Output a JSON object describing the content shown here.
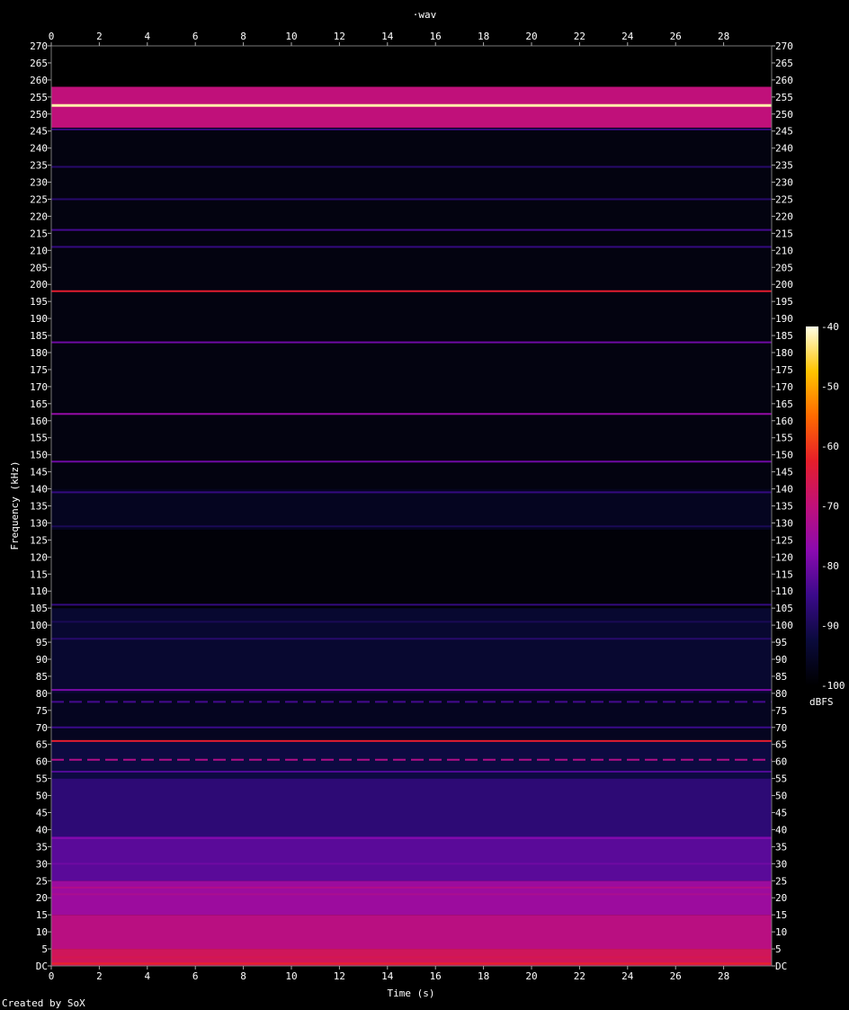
{
  "chart_data": {
    "type": "heatmap",
    "title": "·wav",
    "xlabel": "Time (s)",
    "ylabel": "Frequency (kHz)",
    "xlim": [
      0,
      30
    ],
    "ylim": [
      0,
      270
    ],
    "x_ticks": [
      0,
      2,
      4,
      6,
      8,
      10,
      12,
      14,
      16,
      18,
      20,
      22,
      24,
      26,
      28
    ],
    "y_ticks": [
      0,
      5,
      10,
      15,
      20,
      25,
      30,
      35,
      40,
      45,
      50,
      55,
      60,
      65,
      70,
      75,
      80,
      85,
      90,
      95,
      100,
      105,
      110,
      115,
      120,
      125,
      130,
      135,
      140,
      145,
      150,
      155,
      160,
      165,
      170,
      175,
      180,
      185,
      190,
      195,
      200,
      205,
      210,
      215,
      220,
      225,
      230,
      235,
      240,
      245,
      250,
      255,
      260,
      265,
      270
    ],
    "y_tick_zero_label": "DC",
    "colorbar": {
      "label": "dBFS",
      "range": [
        -100,
        -40
      ],
      "ticks": [
        -40,
        -50,
        -60,
        -70,
        -80,
        -90,
        -100
      ],
      "colors": [
        "#000000",
        "#0a0a3c",
        "#3a0a8a",
        "#8a0ab0",
        "#c0107a",
        "#e61e2a",
        "#ff6a00",
        "#ffc400",
        "#ffffe6"
      ]
    },
    "bands": [
      {
        "f_lo": 0,
        "f_hi": 5,
        "level_db": -67
      },
      {
        "f_lo": 5,
        "f_hi": 15,
        "level_db": -71
      },
      {
        "f_lo": 15,
        "f_hi": 25,
        "level_db": -75
      },
      {
        "f_lo": 25,
        "f_hi": 38,
        "level_db": -82
      },
      {
        "f_lo": 38,
        "f_hi": 55,
        "level_db": -87
      },
      {
        "f_lo": 55,
        "f_hi": 66,
        "level_db": -92
      },
      {
        "f_lo": 66,
        "f_hi": 80,
        "level_db": -96
      },
      {
        "f_lo": 80,
        "f_hi": 105,
        "level_db": -94
      },
      {
        "f_lo": 105,
        "f_hi": 128,
        "level_db": -99
      },
      {
        "f_lo": 128,
        "f_hi": 140,
        "level_db": -96
      },
      {
        "f_lo": 140,
        "f_hi": 246,
        "level_db": -98
      },
      {
        "f_lo": 246,
        "f_hi": 258,
        "level_db": -70
      },
      {
        "f_lo": 258,
        "f_hi": 270,
        "level_db": -100
      }
    ],
    "tones": [
      {
        "freq": 0.7,
        "level_db": -62
      },
      {
        "freq": 2.5,
        "level_db": -66
      },
      {
        "freq": 21,
        "level_db": -73
      },
      {
        "freq": 23,
        "level_db": -72
      },
      {
        "freq": 30,
        "level_db": -80
      },
      {
        "freq": 37.5,
        "level_db": -78
      },
      {
        "freq": 57,
        "level_db": -83
      },
      {
        "freq": 60.5,
        "level_db": -72,
        "dashed": true
      },
      {
        "freq": 66,
        "level_db": -63
      },
      {
        "freq": 70,
        "level_db": -85
      },
      {
        "freq": 77.5,
        "level_db": -84,
        "dashed": true
      },
      {
        "freq": 81,
        "level_db": -79
      },
      {
        "freq": 96,
        "level_db": -88
      },
      {
        "freq": 101,
        "level_db": -90
      },
      {
        "freq": 106,
        "level_db": -86
      },
      {
        "freq": 129,
        "level_db": -90
      },
      {
        "freq": 139,
        "level_db": -86
      },
      {
        "freq": 148,
        "level_db": -80
      },
      {
        "freq": 162,
        "level_db": -76
      },
      {
        "freq": 183,
        "level_db": -80
      },
      {
        "freq": 198,
        "level_db": -63
      },
      {
        "freq": 211,
        "level_db": -86
      },
      {
        "freq": 216,
        "level_db": -84
      },
      {
        "freq": 225,
        "level_db": -88
      },
      {
        "freq": 234.5,
        "level_db": -88
      },
      {
        "freq": 245.5,
        "level_db": -86
      },
      {
        "freq": 252.5,
        "level_db": -42
      }
    ]
  },
  "footer": {
    "credit": "Created by SoX"
  }
}
